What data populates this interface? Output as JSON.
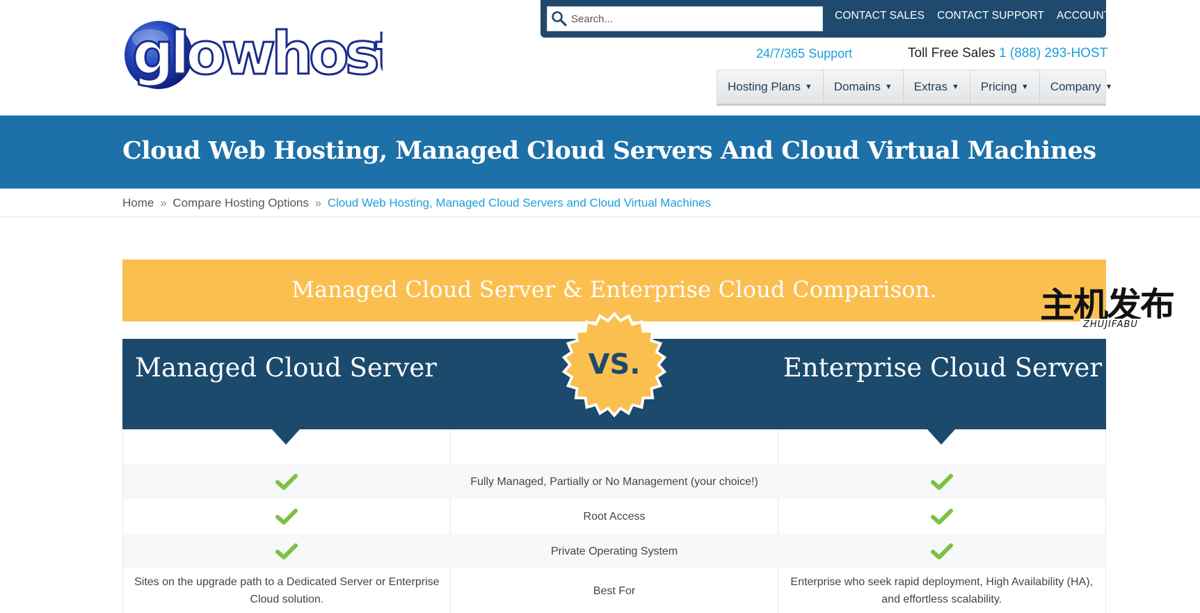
{
  "logo": {
    "text": "glowhost"
  },
  "search": {
    "placeholder": "Search..."
  },
  "top_links": [
    "CONTACT SALES",
    "CONTACT SUPPORT",
    "ACCOUNT LOGIN"
  ],
  "support_link": "24/7/365 Support",
  "tollfree": {
    "label": "Toll Free Sales",
    "number": "1 (888) 293-HOST"
  },
  "nav": [
    "Hosting Plans",
    "Domains",
    "Extras",
    "Pricing",
    "Company"
  ],
  "page_title": "Cloud Web Hosting, Managed Cloud Servers And Cloud Virtual Machines",
  "breadcrumb": {
    "home": "Home",
    "sep": "»",
    "compare": "Compare Hosting Options",
    "current": "Cloud Web Hosting, Managed Cloud Servers and Cloud Virtual Machines"
  },
  "comparison": {
    "banner": "Managed Cloud Server & Enterprise Cloud Comparison.",
    "left_plan": "Managed Cloud Server",
    "right_plan": "Enterprise Cloud Server",
    "vs_label": "VS.",
    "rows": [
      {
        "feature": "Fully Managed, Partially or No Management (your choice!)",
        "left": "check",
        "right": "check"
      },
      {
        "feature": "Root Access",
        "left": "check",
        "right": "check"
      },
      {
        "feature": "Private Operating System",
        "left": "check",
        "right": "check"
      },
      {
        "feature": "Best For",
        "left": "Sites on the upgrade path to a Dedicated Server or Enterprise Cloud solution.",
        "right": "Enterprise who seek rapid deployment, High Availability (HA), and effortless scalability."
      }
    ]
  },
  "watermark": {
    "main": "主机发布",
    "sub": "ZHUJIFABU"
  },
  "colors": {
    "brand_blue": "#1d70a8",
    "navy": "#1b4a6d",
    "accent_yellow": "#fbbf50",
    "link_blue": "#1a9fd9",
    "check_green": "#7cc142"
  }
}
